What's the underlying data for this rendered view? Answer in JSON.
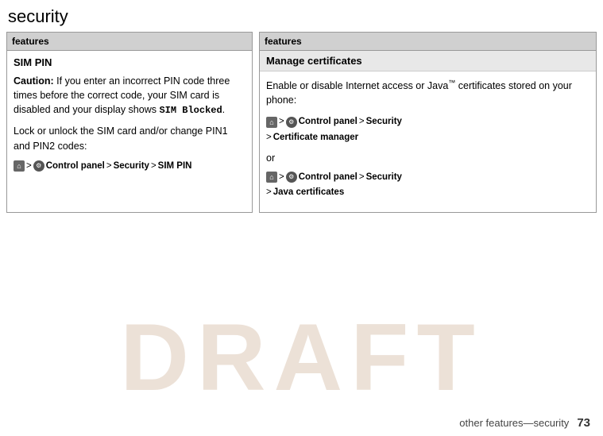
{
  "page": {
    "title": "security",
    "draft_watermark": "DRAFT",
    "footer_text": "other features—security",
    "page_number": "73"
  },
  "left_table": {
    "header": "features",
    "section_title": "SIM PIN",
    "caution_label": "Caution:",
    "caution_body": " If you enter an incorrect PIN code three times before the correct code, your SIM card is disabled and your display shows ",
    "sim_blocked": "SIM Blocked",
    "lock_text": "Lock or unlock the SIM card and/or change PIN1 and PIN2 codes:",
    "nav_home_icon": "⌂",
    "nav_gt1": ">",
    "nav_gear_icon": "⚙",
    "nav_control_panel": "Control panel",
    "nav_gt2": ">",
    "nav_security": "Security",
    "nav_gt3": ">",
    "nav_sim_pin": "SIM PIN"
  },
  "right_table": {
    "header": "features",
    "section_title": "Manage certificates",
    "intro": "Enable or disable Internet access or Java™ certificates stored on your phone:",
    "block1": {
      "nav_home_icon": "⌂",
      "nav_gt1": ">",
      "nav_gear_icon": "⚙",
      "nav_control_panel": "Control panel",
      "nav_gt2": ">",
      "nav_security": "Security",
      "nav_gt3": ">",
      "nav_cert_manager": "Certificate manager"
    },
    "or_text": "or",
    "block2": {
      "nav_home_icon": "⌂",
      "nav_gt1": ">",
      "nav_gear_icon": "⚙",
      "nav_control_panel": "Control panel",
      "nav_gt2": ">",
      "nav_security": "Security",
      "nav_gt3": ">",
      "nav_java_certs": "Java certificates"
    }
  }
}
